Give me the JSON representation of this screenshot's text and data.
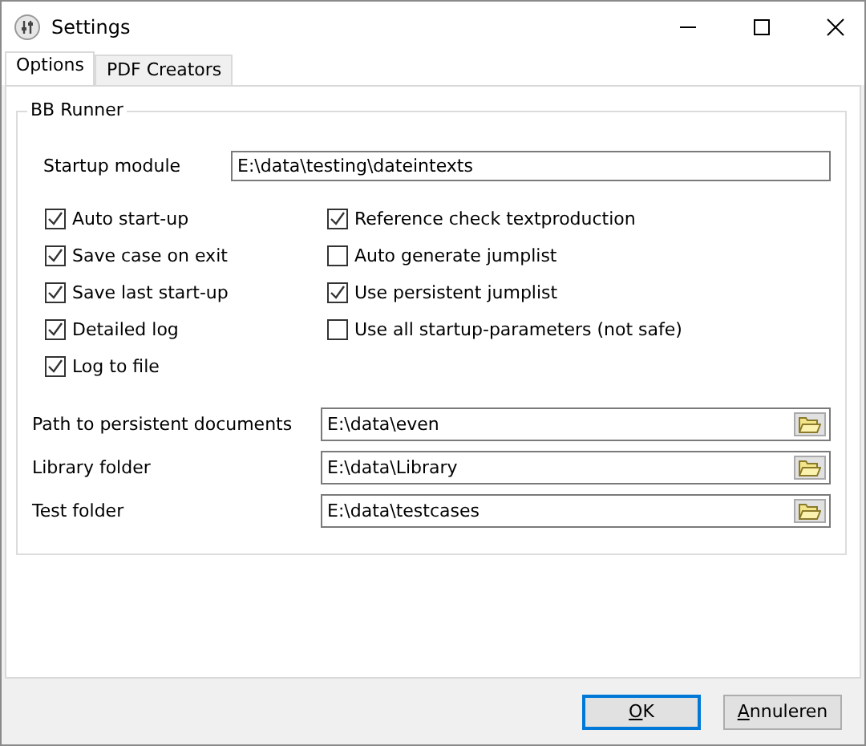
{
  "window": {
    "title": "Settings"
  },
  "tabs": [
    {
      "label": "Options",
      "selected": true
    },
    {
      "label": "PDF Creators",
      "selected": false
    }
  ],
  "group": {
    "title": "BB Runner",
    "startup_module": {
      "label": "Startup module",
      "value": "E:\\data\\testing\\dateintexts"
    },
    "checkbox_columns": [
      [
        {
          "label": "Auto start-up",
          "checked": true
        },
        {
          "label": "Save case on exit",
          "checked": true
        },
        {
          "label": "Save last start-up",
          "checked": true
        },
        {
          "label": "Detailed log",
          "checked": true
        },
        {
          "label": "Log to file",
          "checked": true
        }
      ],
      [
        {
          "label": "Reference check textproduction",
          "checked": true
        },
        {
          "label": "Auto generate jumplist",
          "checked": false
        },
        {
          "label": "Use persistent jumplist",
          "checked": true
        },
        {
          "label": "Use all startup-parameters (not safe)",
          "checked": false
        }
      ]
    ],
    "folders": [
      {
        "label": "Path to persistent documents",
        "value": "E:\\data\\even"
      },
      {
        "label": "Library folder",
        "value": "E:\\data\\Library"
      },
      {
        "label": "Test folder",
        "value": "E:\\data\\testcases"
      }
    ]
  },
  "buttons": [
    {
      "accel": "O",
      "rest": "K",
      "default": true
    },
    {
      "accel": "A",
      "rest": "nnuleren",
      "default": false
    }
  ]
}
